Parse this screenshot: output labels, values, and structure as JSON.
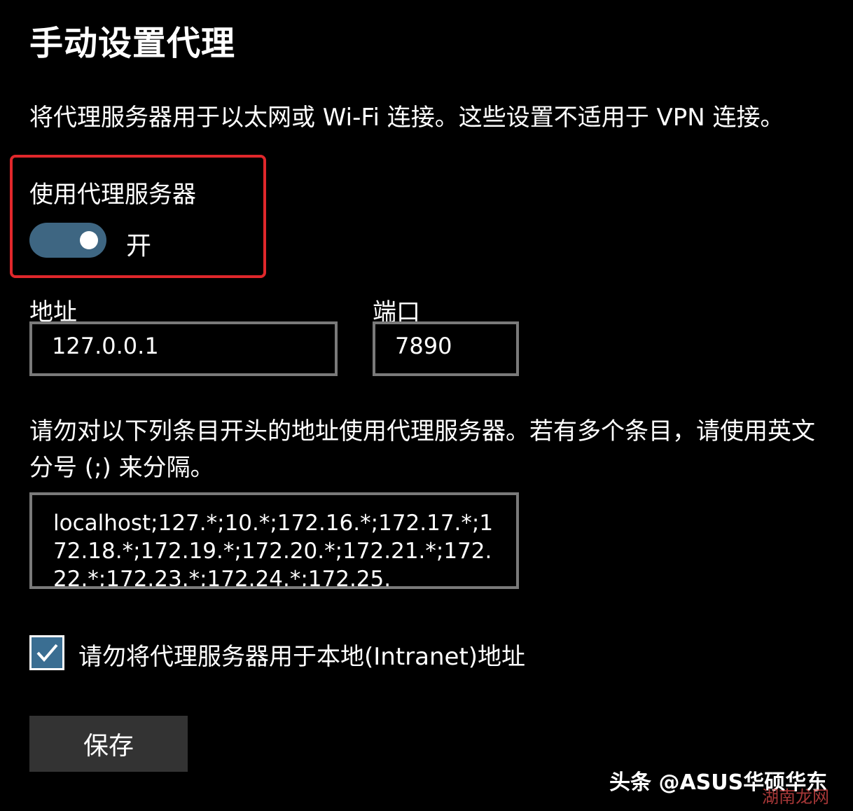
{
  "title": "手动设置代理",
  "description": "将代理服务器用于以太网或 Wi-Fi 连接。这些设置不适用于 VPN 连接。",
  "proxy_toggle": {
    "label": "使用代理服务器",
    "state": "开",
    "on": true
  },
  "address": {
    "label": "地址",
    "value": "127.0.0.1"
  },
  "port": {
    "label": "端口",
    "value": "7890"
  },
  "exceptions": {
    "description": "请勿对以下列条目开头的地址使用代理服务器。若有多个条目，请使用英文分号 (;) 来分隔。",
    "value": "localhost;127.*;10.*;172.16.*;172.17.*;172.18.*;172.19.*;172.20.*;172.21.*;172.22.*;172.23.*;172.24.*;172.25."
  },
  "bypass_local": {
    "label": "请勿将代理服务器用于本地(Intranet)地址",
    "checked": true
  },
  "save_label": "保存",
  "watermark": {
    "text": "头条 @ASUS华硕华东",
    "sub": "湖南龙网"
  },
  "colors": {
    "background": "#000000",
    "toggle_on": "#3e6682",
    "highlight": "#e0272b",
    "checkbox": "#3a6e92",
    "button": "#333333"
  }
}
